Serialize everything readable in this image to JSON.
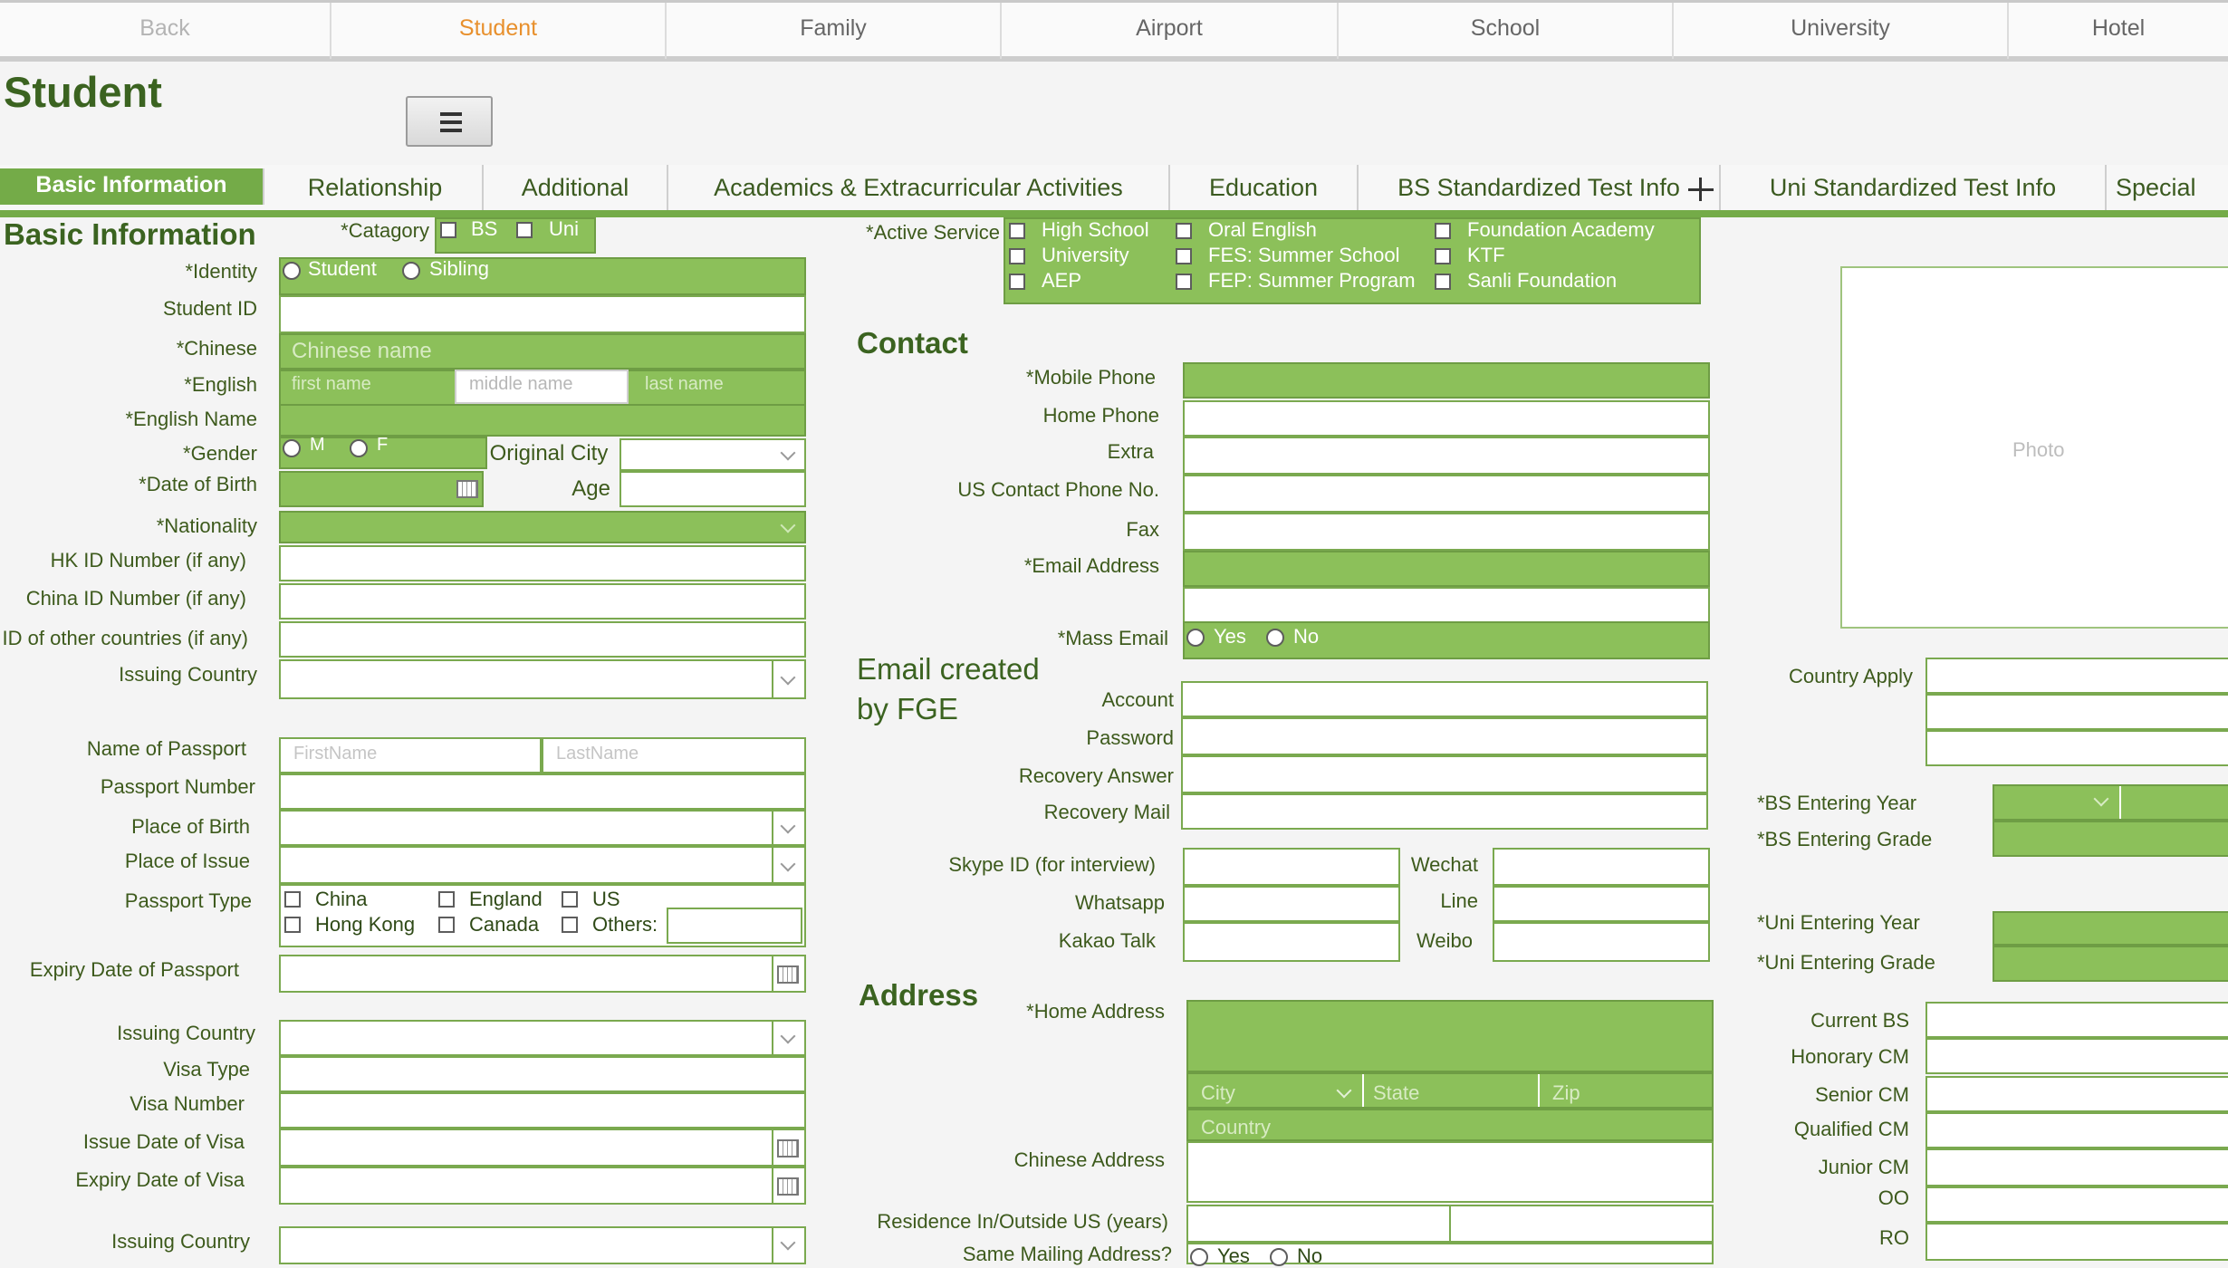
{
  "topnav": [
    "Back",
    "Student",
    "Family",
    "Airport",
    "School",
    "University",
    "Hotel"
  ],
  "page_title": "Student",
  "subtabs": [
    "Basic Information",
    "Relationship",
    "Additional",
    "Academics & Extracurricular Activities",
    "Education",
    "BS Standardized Test Info",
    "Uni Standardized Test Info",
    "Special"
  ],
  "basic": {
    "section": "Basic Information",
    "category_label": "*Catagory",
    "category_options": [
      "BS",
      "Uni"
    ],
    "identity_label": "*Identity",
    "identity_options": [
      "Student",
      "Sibling"
    ],
    "student_id": "Student ID",
    "chinese": "*Chinese",
    "chinese_ph": "Chinese name",
    "english": "*English",
    "first_ph": "first name",
    "middle_ph": "middle name",
    "last_ph": "last name",
    "english_name": "*English Name",
    "gender": "*Gender",
    "gender_m": "M",
    "gender_f": "F",
    "original_city": "Original City",
    "dob": "*Date of Birth",
    "age": "Age",
    "nationality": "*Nationality",
    "hkid": "HK ID Number (if any)",
    "chinaid": "China ID Number (if any)",
    "otherid": "ID of other countries (if any)",
    "issuing_country": "Issuing Country",
    "passport_name": "Name of Passport",
    "passport_first_ph": "FirstName",
    "passport_last_ph": "LastName",
    "passport_number": "Passport Number",
    "place_birth": "Place of Birth",
    "place_issue": "Place of Issue",
    "passport_type": "Passport Type",
    "passport_types": [
      "China",
      "England",
      "US",
      "Hong Kong",
      "Canada",
      "Others:"
    ],
    "expiry_passport": "Expiry Date of Passport",
    "issuing_country2": "Issuing Country",
    "visa_type": "Visa Type",
    "visa_number": "Visa Number",
    "issue_visa": "Issue Date of Visa",
    "expiry_visa": "Expiry Date of Visa",
    "issuing_country3": "Issuing Country"
  },
  "service": {
    "label": "*Active Service",
    "options": [
      "High School",
      "Oral English",
      "Foundation Academy",
      "University",
      "FES: Summer School",
      "KTF",
      "AEP",
      "FEP: Summer Program",
      "Sanli Foundation"
    ]
  },
  "contact": {
    "section": "Contact",
    "mobile": "*Mobile Phone",
    "home": "Home Phone",
    "extra": "Extra",
    "us_phone": "US Contact Phone No.",
    "fax": "Fax",
    "email": "*Email Address",
    "mass_email": "*Mass Email",
    "yes": "Yes",
    "no": "No"
  },
  "fge": {
    "section_1": "Email created",
    "section_2": "by FGE",
    "account": "Account",
    "password": "Password",
    "recovery_answer": "Recovery Answer",
    "recovery_mail": "Recovery Mail"
  },
  "social": {
    "skype": "Skype ID (for interview)",
    "whatsapp": "Whatsapp",
    "kakao": "Kakao Talk",
    "wechat": "Wechat",
    "line": "Line",
    "weibo": "Weibo"
  },
  "address": {
    "section": "Address",
    "home": "*Home Address",
    "city_ph": "City",
    "state_ph": "State",
    "zip_ph": "Zip",
    "country_ph": "Country",
    "chinese": "Chinese Address",
    "residence": "Residence In/Outside US (years)",
    "same_mailing": "Same Mailing Address?",
    "yes": "Yes",
    "no": "No"
  },
  "right": {
    "photo": "Photo",
    "country_apply": "Country Apply",
    "bs_year": "*BS Entering Year",
    "bs_grade": "*BS Entering Grade",
    "uni_year": "*Uni Entering Year",
    "uni_grade": "*Uni Entering Grade",
    "current_bs": "Current BS",
    "honorary_cm": "Honorary CM",
    "senior_cm": "Senior CM",
    "qualified_cm": "Qualified CM",
    "junior_cm": "Junior CM",
    "oo": "OO",
    "ro": "RO"
  }
}
